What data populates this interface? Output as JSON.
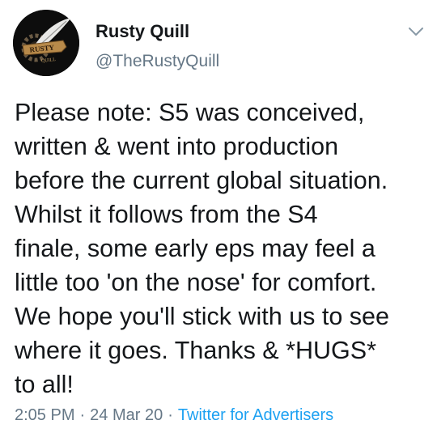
{
  "author": {
    "display_name": "Rusty Quill",
    "handle": "@TheRustyQuill",
    "avatar_banner_text": "RUSTY",
    "avatar_sub_text": "QUILL"
  },
  "tweet": {
    "text": "Please note: S5 was conceived,\nwritten & went into production\nbefore the current global situation.\nWhilst it follows from the S4\nfinale, some early eps may feel a\nlittle too 'on the nose' for comfort.\nWe hope you'll stick with us to see\nwhere it goes. Thanks & *HUGS*\nto all!",
    "time": "2:05 PM",
    "date": "24 Mar 20",
    "separator": "·",
    "source": "Twitter for Advertisers"
  },
  "icons": {
    "menu": "chevron-down-icon"
  },
  "colors": {
    "text": "#14171a",
    "muted": "#657786",
    "link": "#1da1f2",
    "background": "#ffffff"
  }
}
